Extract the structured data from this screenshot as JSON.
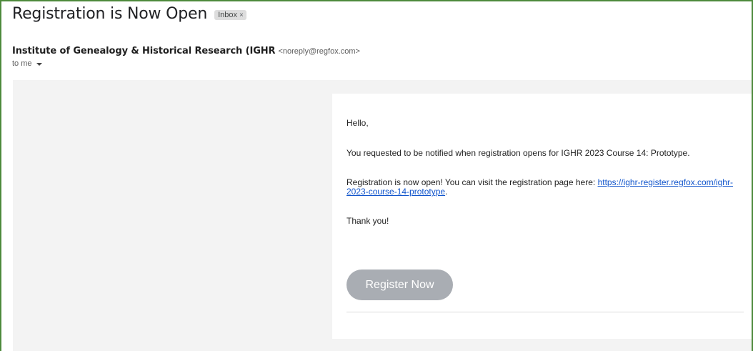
{
  "email": {
    "subject": "Registration is Now Open",
    "label": "Inbox",
    "label_close": "×",
    "sender_name": "Institute of Genealogy & Historical Research (IGHR",
    "sender_email": "<noreply@regfox.com>",
    "recipient": "to me"
  },
  "body": {
    "greeting": "Hello,",
    "request_line": "You requested to be notified when registration opens for IGHR 2023 Course 14: Prototype.",
    "open_line_prefix": "Registration is now open! You can visit the registration page here: ",
    "registration_link": "https://ighr-register.regfox.com/ighr-2023-course-14-prototype",
    "open_line_suffix": ".",
    "thanks": "Thank you!",
    "button_label": "Register Now"
  },
  "colors": {
    "frame_border": "#4e8a3c",
    "link": "#1155cc",
    "button_bg": "#a9adb3",
    "body_bg": "#f3f3f3"
  }
}
